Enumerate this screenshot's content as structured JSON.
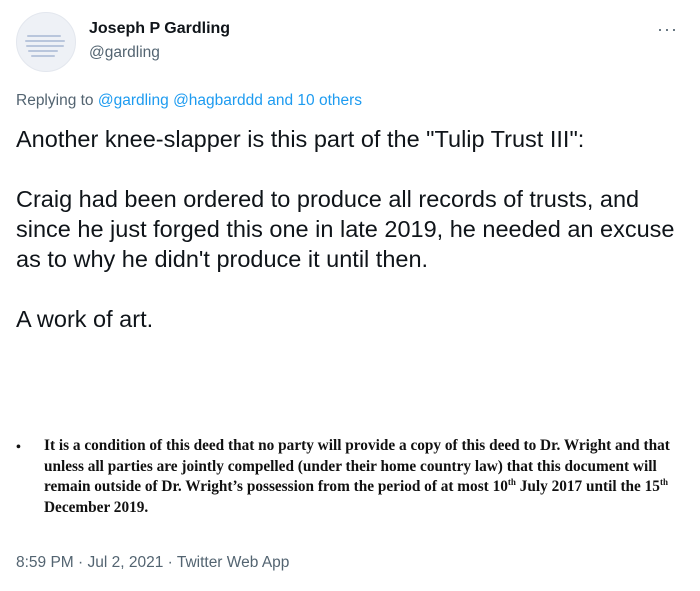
{
  "author": {
    "name": "Joseph P Gardling",
    "handle": "@gardling"
  },
  "reply": {
    "prefix": "Replying to ",
    "mention1": "@gardling",
    "mention2": "@hagbarddd",
    "suffix": "and 10 others"
  },
  "tweet": {
    "para1": "Another knee-slapper is this part of the \"Tulip Trust III\":",
    "para2": "Craig had been ordered to produce all records of trusts, and since he just forged this one in late 2019, he needed an excuse as to why he didn't produce it until then.",
    "para3": "A work of art."
  },
  "document_excerpt": {
    "bullet": "•",
    "text_before": "It is a condition of this deed that no party will provide a copy of this deed to Dr. Wright and that unless all parties are jointly compelled (under their home country law) that this document will remain outside of Dr. Wright’s possession from the period of at most 10",
    "sup1": "th",
    "text_middle": " July 2017 until the 15",
    "sup2": "th",
    "text_after": " December 2019."
  },
  "meta": {
    "timestamp": "8:59 PM · Jul 2, 2021 · Twitter Web App"
  },
  "icons": {
    "more": "more-options-icon",
    "avatar": "profile-avatar"
  },
  "colors": {
    "link": "#1d9bf0",
    "secondary_text": "#536471",
    "primary_text": "#0f1419"
  }
}
